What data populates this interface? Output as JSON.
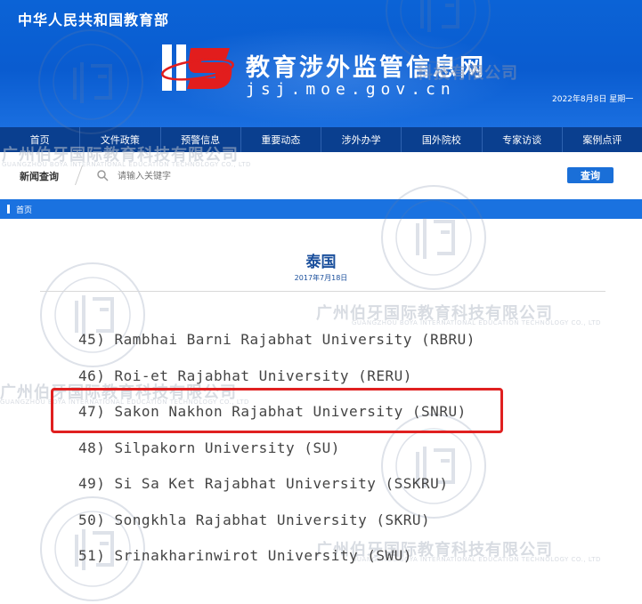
{
  "header": {
    "ministry_name": "中华人民共和国教育部",
    "site_title": "教育涉外监管信息网",
    "site_domain": "jsj.moe.gov.cn",
    "date": "2022年8月8日 星期一",
    "brand_color": "#0b63d6"
  },
  "nav": {
    "items": [
      {
        "label": "首页"
      },
      {
        "label": "文件政策"
      },
      {
        "label": "预警信息"
      },
      {
        "label": "重要动态"
      },
      {
        "label": "涉外办学"
      },
      {
        "label": "国外院校"
      },
      {
        "label": "专家访谈"
      },
      {
        "label": "案例点评"
      }
    ]
  },
  "search": {
    "label": "新闻查询",
    "placeholder": "请输入关键字",
    "button_label": "查询"
  },
  "breadcrumb": {
    "home": "首页"
  },
  "article": {
    "title": "泰国",
    "date": "2017年7月18日",
    "universities": [
      "45) Rambhai Barni Rajabhat University (RBRU)",
      "46) Roi-et Rajabhat University (RERU)",
      "47) Sakon Nakhon Rajabhat University (SNRU)",
      "48) Silpakorn University (SU)",
      "49) Si Sa Ket Rajabhat University (SSKRU)",
      "50) Songkhla Rajabhat University (SKRU)",
      "51) Srinakharinwirot University (SWU)"
    ],
    "highlighted_index": 2,
    "highlight_color": "#e02020"
  },
  "watermark": {
    "company_cn": "广州伯牙国际教育科技有限公司",
    "company_en": "GUANGZHOU BOYA INTERNATIONAL EDUCATION TECHNOLOGY CO., LTD",
    "seal_cn": "伯牙国际教育",
    "seal_en": "BOYA INTERNATIONAL EDUCATION"
  }
}
